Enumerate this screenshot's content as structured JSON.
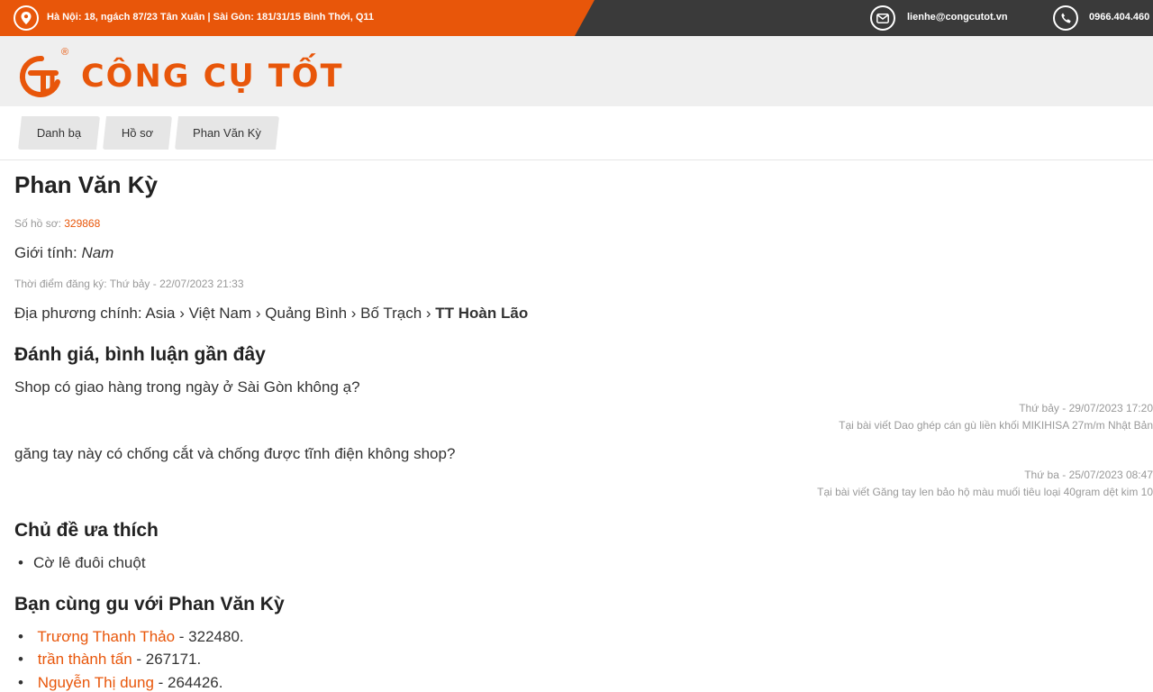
{
  "topbar": {
    "address": "Hà Nội: 18, ngách 87/23 Tân Xuân | Sài Gòn: 181/31/15 Bình Thới, Q11",
    "email": "lienhe@congcutot.vn",
    "phone": "0966.404.460"
  },
  "brand": {
    "name": "CÔNG CỤ TỐT",
    "registered": "®",
    "color": "#e8560a"
  },
  "breadcrumb": [
    "Danh bạ",
    "Hồ sơ",
    "Phan Văn Kỳ"
  ],
  "profile": {
    "name": "Phan Văn Kỳ",
    "file_label": "Số hồ sơ: ",
    "file_number": "329868",
    "gender_label": "Giới tính: ",
    "gender": "Nam",
    "registered_at": "Thời điểm đăng ký: Thứ bảy - 22/07/2023 21:33",
    "location_label": "Địa phương chính: Asia › Việt Nam › Quảng Bình › Bố Trạch › ",
    "location_last": "TT Hoàn Lão"
  },
  "reviews": {
    "heading": "Đánh giá, bình luận gần đây",
    "items": [
      {
        "text": "Shop có giao hàng trong ngày ở Sài Gòn không ạ?",
        "date": "Thứ bảy - 29/07/2023 17:20",
        "post": "Tại bài viết Dao ghép cán gù liền khối MIKIHISA 27m/m Nhật Bản"
      },
      {
        "text": "găng tay này có chống cắt và chống được tĩnh điện không shop?",
        "date": "Thứ ba - 25/07/2023 08:47",
        "post": "Tại bài viết Găng tay len bảo hộ màu muối tiêu loại 40gram dệt kim 10"
      }
    ]
  },
  "favorites": {
    "heading": "Chủ đề ưa thích",
    "items": [
      "Cờ lê đuôi chuột"
    ]
  },
  "peers": {
    "heading": "Bạn cùng gu với Phan Văn Kỳ",
    "items": [
      {
        "name": "Trương Thanh Thảo",
        "suffix": " - 322480."
      },
      {
        "name": "trần thành tấn",
        "suffix": " - 267171."
      },
      {
        "name": "Nguyễn Thị dung",
        "suffix": " - 264426."
      }
    ]
  },
  "icons": {
    "location": "map-pin-icon",
    "email": "envelope-icon",
    "phone": "phone-icon"
  }
}
